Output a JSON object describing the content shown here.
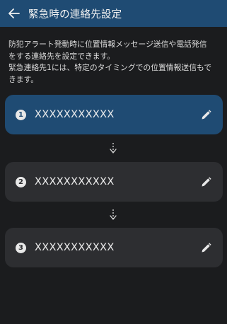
{
  "header": {
    "title": "緊急時の連絡先設定",
    "back_icon": "arrow-left-icon"
  },
  "description": "防犯アラート発動時に位置情報メッセージ送信や電話発信\nをする連絡先を設定できます。\n緊急連絡先1には、特定のタイミングでの位置情報送信もで\nきます。",
  "contacts": [
    {
      "number": "1",
      "value": "XXXXXXXXXXX",
      "active": true,
      "edit_icon": "pencil-icon"
    },
    {
      "number": "2",
      "value": "XXXXXXXXXXX",
      "active": false,
      "edit_icon": "pencil-icon"
    },
    {
      "number": "3",
      "value": "XXXXXXXXXXX",
      "active": false,
      "edit_icon": "pencil-icon"
    }
  ],
  "connector_icon": "dotted-arrow-down-icon",
  "colors": {
    "header_bg": "#1f4b73",
    "active_card_bg": "#1f4b73",
    "card_bg": "#2d2e31",
    "page_bg": "#1b1c1e"
  }
}
